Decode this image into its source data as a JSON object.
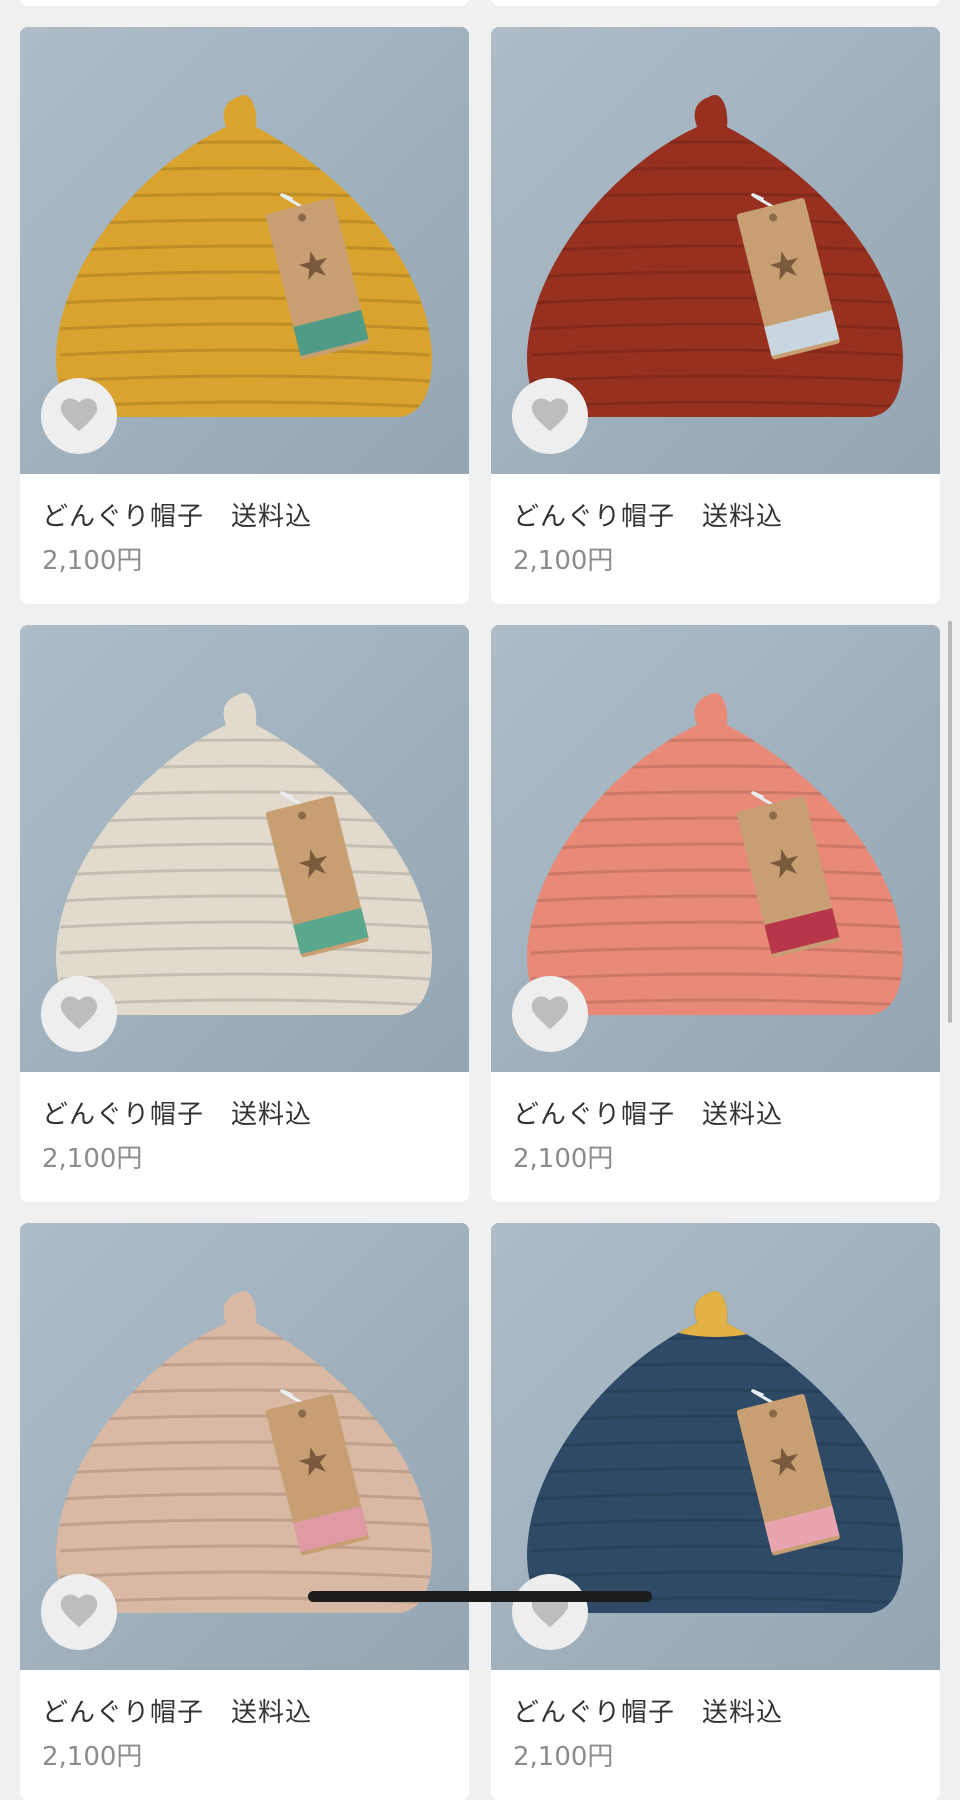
{
  "products": [
    {
      "title": "どんぐり帽子　送料込",
      "price": "2,100円",
      "hat_color": "#d9a32e",
      "tag_stripe": "#4f9b86",
      "favorite_icon": "heart-icon"
    },
    {
      "title": "どんぐり帽子　送料込",
      "price": "2,100円",
      "hat_color": "#97301f",
      "tag_stripe": "#c9d6e0",
      "favorite_icon": "heart-icon"
    },
    {
      "title": "どんぐり帽子　送料込",
      "price": "2,100円",
      "hat_color": "#e2dbcd",
      "tag_stripe": "#59a78d",
      "favorite_icon": "heart-icon"
    },
    {
      "title": "どんぐり帽子　送料込",
      "price": "2,100円",
      "hat_color": "#e98a78",
      "tag_stripe": "#b8364a",
      "favorite_icon": "heart-icon"
    },
    {
      "title": "どんぐり帽子　送料込",
      "price": "2,100円",
      "hat_color": "#d9b9a3",
      "tag_stripe": "#df9aa4",
      "favorite_icon": "heart-icon"
    },
    {
      "title": "どんぐり帽子　送料込",
      "price": "2,100円",
      "hat_color": "#2e4a66",
      "top_color": "#e3b246",
      "tag_stripe": "#e8a5b0",
      "favorite_icon": "heart-icon"
    }
  ],
  "colors": {
    "background": "#f0f0f0",
    "card": "#ffffff",
    "title_text": "#333333",
    "price_text": "#8c8c8c",
    "photo_backdrop": "#9fb0bd"
  }
}
